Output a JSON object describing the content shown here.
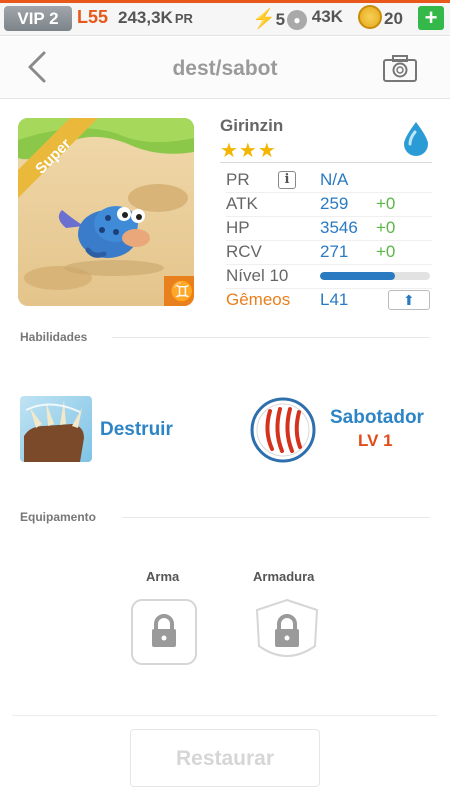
{
  "statusbar": {
    "vip": "VIP 2",
    "level": "L55",
    "power_value": "243,3K",
    "power_unit": "PR",
    "energy": "5",
    "food": "43K",
    "coins": "20",
    "add": "+"
  },
  "nav": {
    "title": "dest/sabot"
  },
  "monster": {
    "name": "Girinzin",
    "rank_ribbon": "Super",
    "stars": "★★★",
    "element": "water",
    "sign": "♊"
  },
  "stats": {
    "pr_label": "PR",
    "pr_value": "N/A",
    "info": "i",
    "atk_label": "ATK",
    "atk_value": "259",
    "atk_bonus": "+0",
    "hp_label": "HP",
    "hp_value": "3546",
    "hp_bonus": "+0",
    "rcv_label": "RCV",
    "rcv_value": "271",
    "rcv_bonus": "+0",
    "level_label": "Nível 10",
    "level_progress": 0.68,
    "twins_label": "Gêmeos",
    "twins_value": "L41"
  },
  "abilities": {
    "section_title": "Habilidades",
    "skill1": "Destruir",
    "skill2": "Sabotador",
    "skill2_level": "LV 1"
  },
  "equipment": {
    "section_title": "Equipamento",
    "weapon": "Arma",
    "armor": "Armadura"
  },
  "restore_button": "Restaurar",
  "colors": {
    "accent": "#e8581a",
    "blue": "#2a7ac2",
    "green": "#5bb648",
    "gold": "#f2b600"
  }
}
